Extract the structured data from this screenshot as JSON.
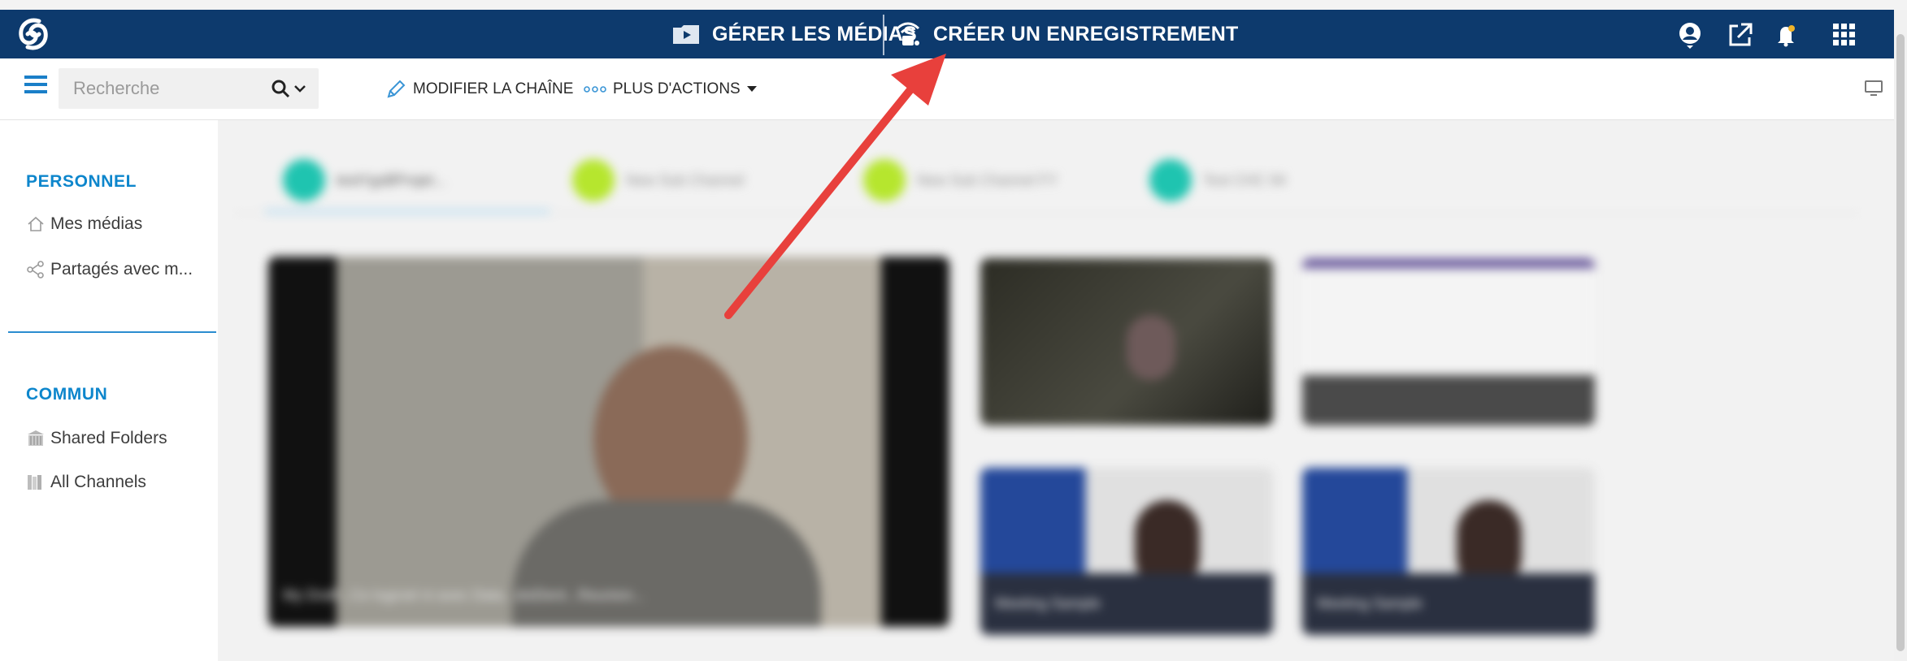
{
  "topbar": {
    "logo": "swirl-logo-icon",
    "manage_media_label": "GÉRER LES MÉDIAS",
    "create_recording_label": "CRÉER UN ENREGISTREMENT",
    "icons": [
      "user-account-icon",
      "external-link-icon",
      "notification-bell-icon",
      "app-grid-icon"
    ],
    "bg_color": "#0d3a6d"
  },
  "toolbar": {
    "search_placeholder": "Recherche",
    "edit_channel_label": "MODIFIER LA CHAÎNE",
    "more_actions_label": "PLUS D'ACTIONS"
  },
  "sidebar": {
    "personal_title": "PERSONNEL",
    "my_media": "Mes médias",
    "shared_with_me": "Partagés avec m...",
    "common_title": "COMMUN",
    "shared_folders": "Shared Folders",
    "all_channels": "All Channels",
    "accent_color": "#0d86cc"
  },
  "main": {
    "tabs": [
      {
        "label": "testYgsBProjet...",
        "color": "#1fc4b0"
      },
      {
        "label": "New Sub Channel",
        "color": "#b6e62e"
      },
      {
        "label": "New Sub Channel FY",
        "color": "#b6e62e"
      },
      {
        "label": "Test CHC 94",
        "color": "#1fc4b0"
      }
    ],
    "videos": [
      {
        "title": "My Draft...Ce logiciel ni avec Data...doiDent...Reunion..."
      },
      {
        "title": ""
      },
      {
        "title": ""
      },
      {
        "title": "Meeting Sample"
      },
      {
        "title": "Meeting Sample"
      }
    ]
  },
  "annotation": {
    "arrow_color": "#e8403c"
  }
}
